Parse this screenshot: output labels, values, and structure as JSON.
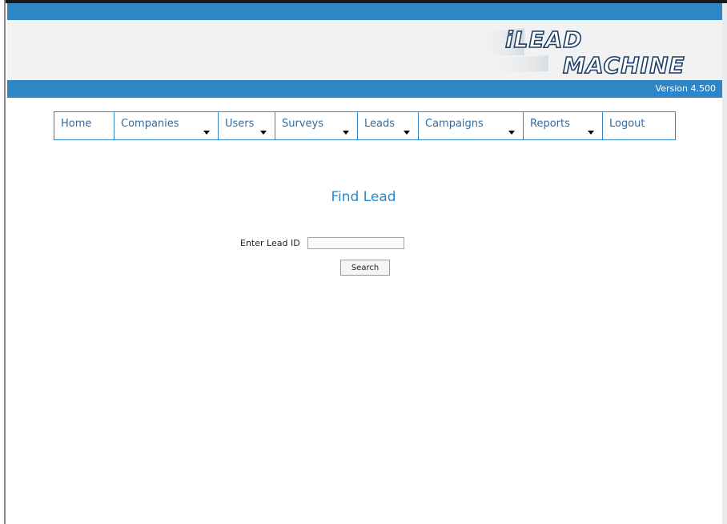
{
  "header": {
    "logo_line1": "iLEAD",
    "logo_line2": "MACHINE",
    "version": "Version 4.500"
  },
  "colors": {
    "brand_blue": "#2f86c6",
    "nav_text": "#2e6da4",
    "title_blue": "#2e86c6"
  },
  "nav": {
    "items": [
      {
        "label": "Home",
        "has_dropdown": false
      },
      {
        "label": "Companies",
        "has_dropdown": true
      },
      {
        "label": "Users",
        "has_dropdown": true
      },
      {
        "label": "Surveys",
        "has_dropdown": true
      },
      {
        "label": "Leads",
        "has_dropdown": true
      },
      {
        "label": "Campaigns",
        "has_dropdown": true
      },
      {
        "label": "Reports",
        "has_dropdown": true
      },
      {
        "label": "Logout",
        "has_dropdown": false
      }
    ]
  },
  "main": {
    "title": "Find Lead",
    "lead_id_label": "Enter Lead ID",
    "lead_id_value": "",
    "search_label": "Search"
  }
}
